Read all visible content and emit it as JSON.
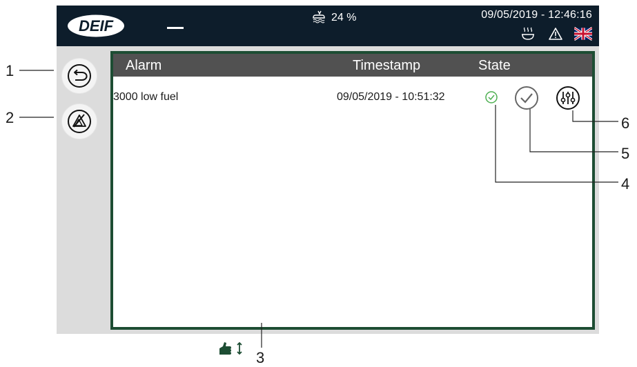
{
  "topbar": {
    "logo_text": "DEIF",
    "fuel_level": "24 %",
    "datetime": "09/05/2019 - 12:46:16"
  },
  "panel": {
    "headers": {
      "alarm": "Alarm",
      "timestamp": "Timestamp",
      "state": "State"
    },
    "rows": [
      {
        "alarm": "3000 low fuel",
        "timestamp": "09/05/2019 - 10:51:32"
      }
    ]
  },
  "callouts": [
    "1",
    "2",
    "3",
    "4",
    "5",
    "6"
  ],
  "colors": {
    "topbar_bg": "#0d1d2b",
    "panel_border": "#1d4d33",
    "header_bg": "#515151",
    "state_ok": "#4caf50",
    "device_bg": "#dcdcdc"
  },
  "icons": {
    "back": "back-arrow-icon",
    "silence": "silence-alarm-icon",
    "fuel": "fuel-tank-icon",
    "heater": "heater-icon",
    "warning": "warning-triangle-icon",
    "flag": "uk-flag-icon",
    "state_active": "check-circle-small-icon",
    "acknowledge": "acknowledge-check-icon",
    "settings": "parameter-settings-icon",
    "scroll": "swipe-scroll-icon"
  }
}
